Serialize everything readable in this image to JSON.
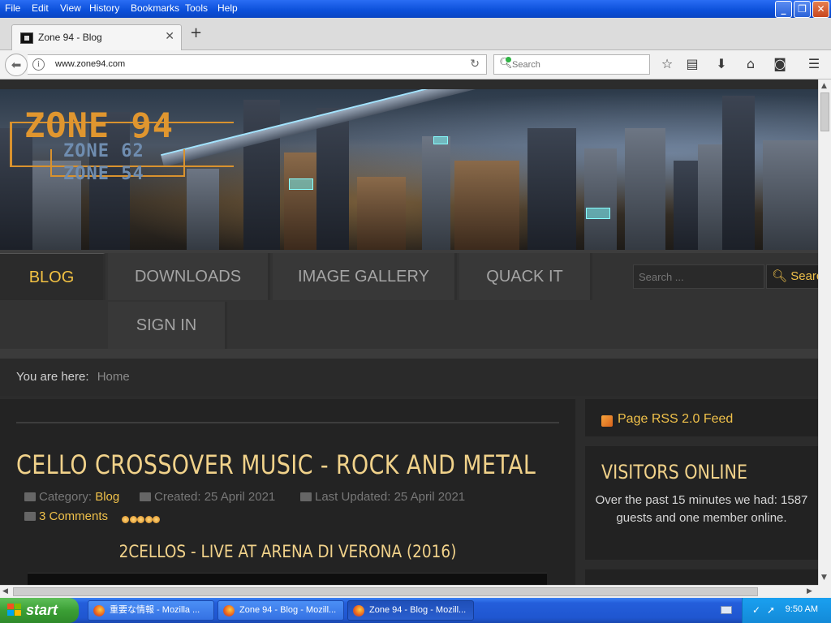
{
  "browser": {
    "menu": [
      "File",
      "Edit",
      "View",
      "History",
      "Bookmarks",
      "Tools",
      "Help"
    ],
    "window_buttons": {
      "minimize": "_",
      "maximize": "❐",
      "close": "✕"
    },
    "tab": {
      "title": "Zone 94 - Blog",
      "close": "✕"
    },
    "new_tab": "+",
    "url": "www.zone94.com",
    "search_placeholder": "Search",
    "toolbar_icons": [
      "bookmark-star-icon",
      "reading-list-icon",
      "downloads-icon",
      "home-icon",
      "pocket-icon",
      "hamburger-menu-icon"
    ]
  },
  "banner": {
    "logo_main": "ZONE 94",
    "logo_sub_1": "ZONE 62",
    "logo_sub_2": "ZONE 54"
  },
  "nav": {
    "items": [
      "BLOG",
      "DOWNLOADS",
      "IMAGE GALLERY",
      "QUACK IT",
      "SIGN IN"
    ],
    "active": "BLOG",
    "search_placeholder": "Search ...",
    "search_button": "Search"
  },
  "breadcrumb": {
    "label": "You are here:",
    "home": "Home"
  },
  "article": {
    "title": "CELLO CROSSOVER MUSIC - ROCK AND METAL",
    "category_label": "Category:",
    "category": "Blog",
    "created": "Created: 25 April 2021",
    "updated": "Last Updated: 25 April 2021",
    "comments": "3 Comments",
    "rating_stars": 5,
    "subtitle": "2CELLOS - LIVE AT ARENA DI VERONA (2016)"
  },
  "sidebar": {
    "rss": "Page RSS 2.0 Feed",
    "visitors_title": "VISITORS ONLINE",
    "visitors_text": "Over the past 15 minutes we had: 1587 guests and one member online."
  },
  "taskbar": {
    "start": "start",
    "items": [
      "重要な情報 - Mozilla ...",
      "Zone 94 - Blog - Mozill...",
      "Zone 94 - Blog - Mozill..."
    ],
    "active_index": 2,
    "clock": "9:50 AM"
  },
  "colors": {
    "accent_gold": "#f0c14a",
    "title_gold": "#f1d28a",
    "xp_blue": "#0b4fd9",
    "start_green": "#3b9f35"
  }
}
